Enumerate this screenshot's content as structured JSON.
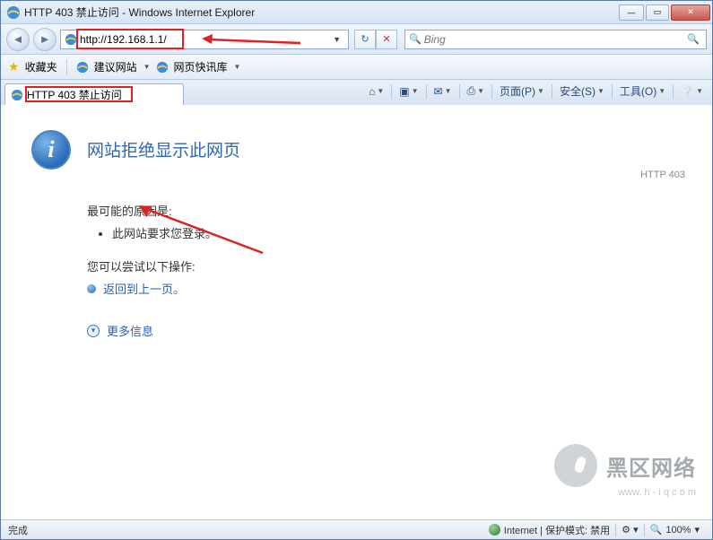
{
  "window": {
    "title": "HTTP 403 禁止访问 - Windows Internet Explorer"
  },
  "nav": {
    "back": "◄",
    "fwd": "►",
    "url": "http://192.168.1.1/",
    "refresh": "↻",
    "stop": "✕",
    "search_placeholder": "Bing",
    "search_icon": "🔍"
  },
  "fav": {
    "label": "收藏夹",
    "suggest": "建议网站",
    "quick": "网页快讯库"
  },
  "tab": {
    "title": "HTTP 403 禁止访问"
  },
  "cmdbar": {
    "home": "⌂",
    "rss": "▣",
    "mail": "✉",
    "print": "⎙",
    "page": "页面(P)",
    "safe": "安全(S)",
    "tools": "工具(O)",
    "help": "❔"
  },
  "page": {
    "heading": "网站拒绝显示此网页",
    "code": "HTTP 403",
    "cause_label": "最可能的原因是:",
    "cause_item": "此网站要求您登录。",
    "try_label": "您可以尝试以下操作:",
    "back_link": "返回到上一页。",
    "more_info": "更多信息"
  },
  "watermark": {
    "text": "黑区网络",
    "sub": "www. h - i q  c o m"
  },
  "status": {
    "done": "完成",
    "zone": "Internet | 保护模式: 禁用",
    "zoom": "100%",
    "zoom_icon": "🔍"
  }
}
